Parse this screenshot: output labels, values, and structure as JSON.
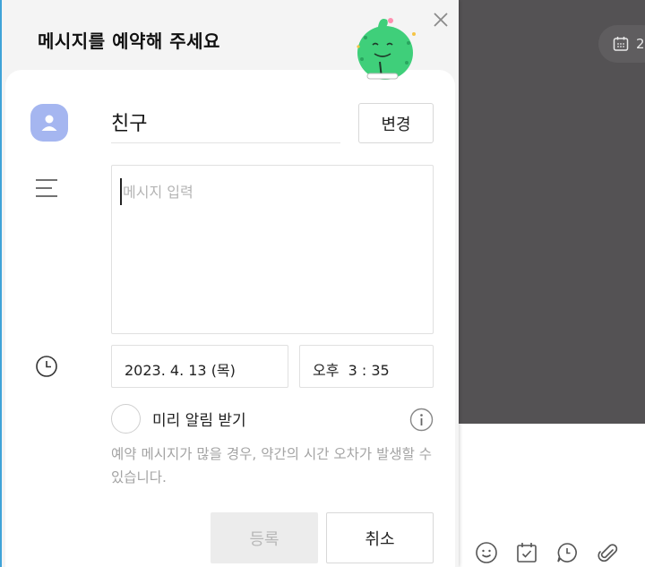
{
  "dialog": {
    "title": "메시지를 예약해 주세요",
    "recipient_name": "친구",
    "change_label": "변경",
    "message_placeholder": "메시지 입력",
    "date_value": "2023. 4. 13 (목)",
    "time_value": "오후  3 : 35",
    "reminder_label": "미리 알림 받기",
    "reminder_checked": false,
    "notice": "예약 메시지가 많을 경우, 약간의 시간 오차가 발생할 수 있습니다.",
    "submit_label": "등록",
    "cancel_label": "취소"
  },
  "background_chat": {
    "date_chip_text": "2"
  },
  "icons": {
    "close": "close-icon",
    "mascot": "mascot-character",
    "avatar": "user-avatar-icon",
    "message": "lines-icon",
    "clock": "clock-icon",
    "info": "info-icon",
    "calendar": "calendar-icon",
    "emoji": "emoji-icon",
    "schedule": "calendar-check-icon",
    "chat_bubble": "chat-bubble-icon",
    "attach": "paperclip-icon"
  },
  "colors": {
    "accent_border": "#3fa3d8",
    "avatar_bg": "#a5b6f0",
    "mascot_green": "#3fcf7a",
    "chat_bg": "#545254"
  }
}
